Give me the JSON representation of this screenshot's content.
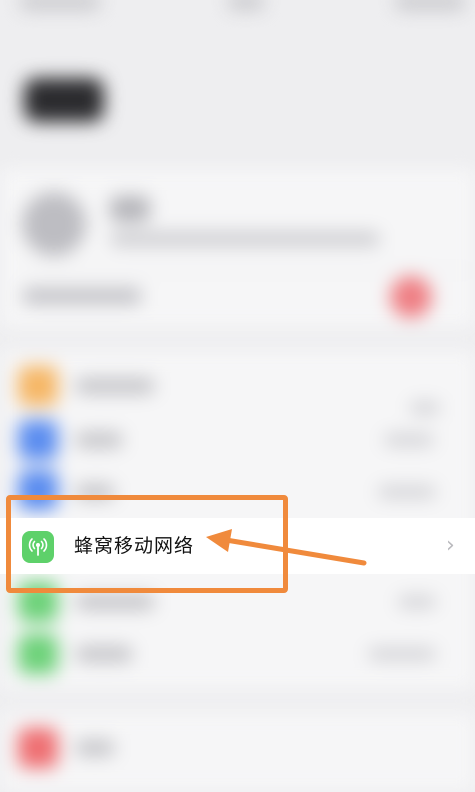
{
  "settings": {
    "cellular_label": "蜂窝移动网络"
  },
  "annotation": {
    "color": "#f08a3c"
  },
  "icons": {
    "cellular": "antenna-icon",
    "chevron": "chevron-right-icon"
  },
  "chevron_glyph": "›"
}
